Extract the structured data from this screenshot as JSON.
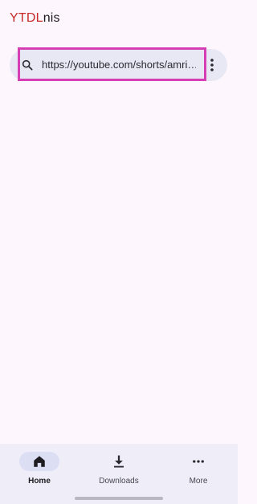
{
  "app": {
    "title_brand": "YTDL",
    "title_rest": "nis"
  },
  "search": {
    "value": "https://youtube.com/shorts/amri…",
    "icon": "search-icon",
    "menu_icon": "more-vert-icon"
  },
  "nav": {
    "items": [
      {
        "label": "Home",
        "icon": "home-icon",
        "active": true
      },
      {
        "label": "Downloads",
        "icon": "download-icon",
        "active": false
      },
      {
        "label": "More",
        "icon": "more-horiz-icon",
        "active": false
      }
    ]
  },
  "colors": {
    "brand_red": "#c62828",
    "highlight": "#d63fb4",
    "background": "#fdf7fd"
  }
}
